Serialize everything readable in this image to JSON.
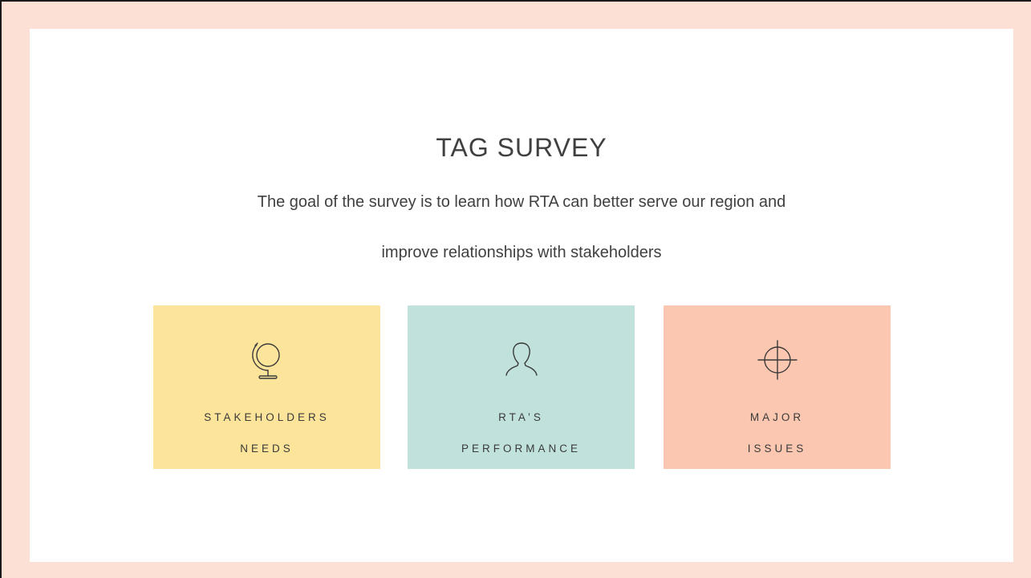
{
  "slide": {
    "title": "TAG SURVEY",
    "subtitle_line1": "The goal of the survey is to learn how RTA can better serve our region and",
    "subtitle_line2": "improve relationships with stakeholders"
  },
  "cards": [
    {
      "icon": "globe-icon",
      "label_line1": "STAKEHOLDERS",
      "label_line2": "NEEDS",
      "color": "#fde49b"
    },
    {
      "icon": "person-icon",
      "label_line1": "RTA’S",
      "label_line2": "PERFORMANCE",
      "color": "#c1e2dc"
    },
    {
      "icon": "crosshair-icon",
      "label_line1": "MAJOR",
      "label_line2": "ISSUES",
      "color": "#fcc7b0"
    }
  ],
  "colors": {
    "frame": "#fde0d5",
    "panel": "#ffffff",
    "text": "#404040"
  }
}
